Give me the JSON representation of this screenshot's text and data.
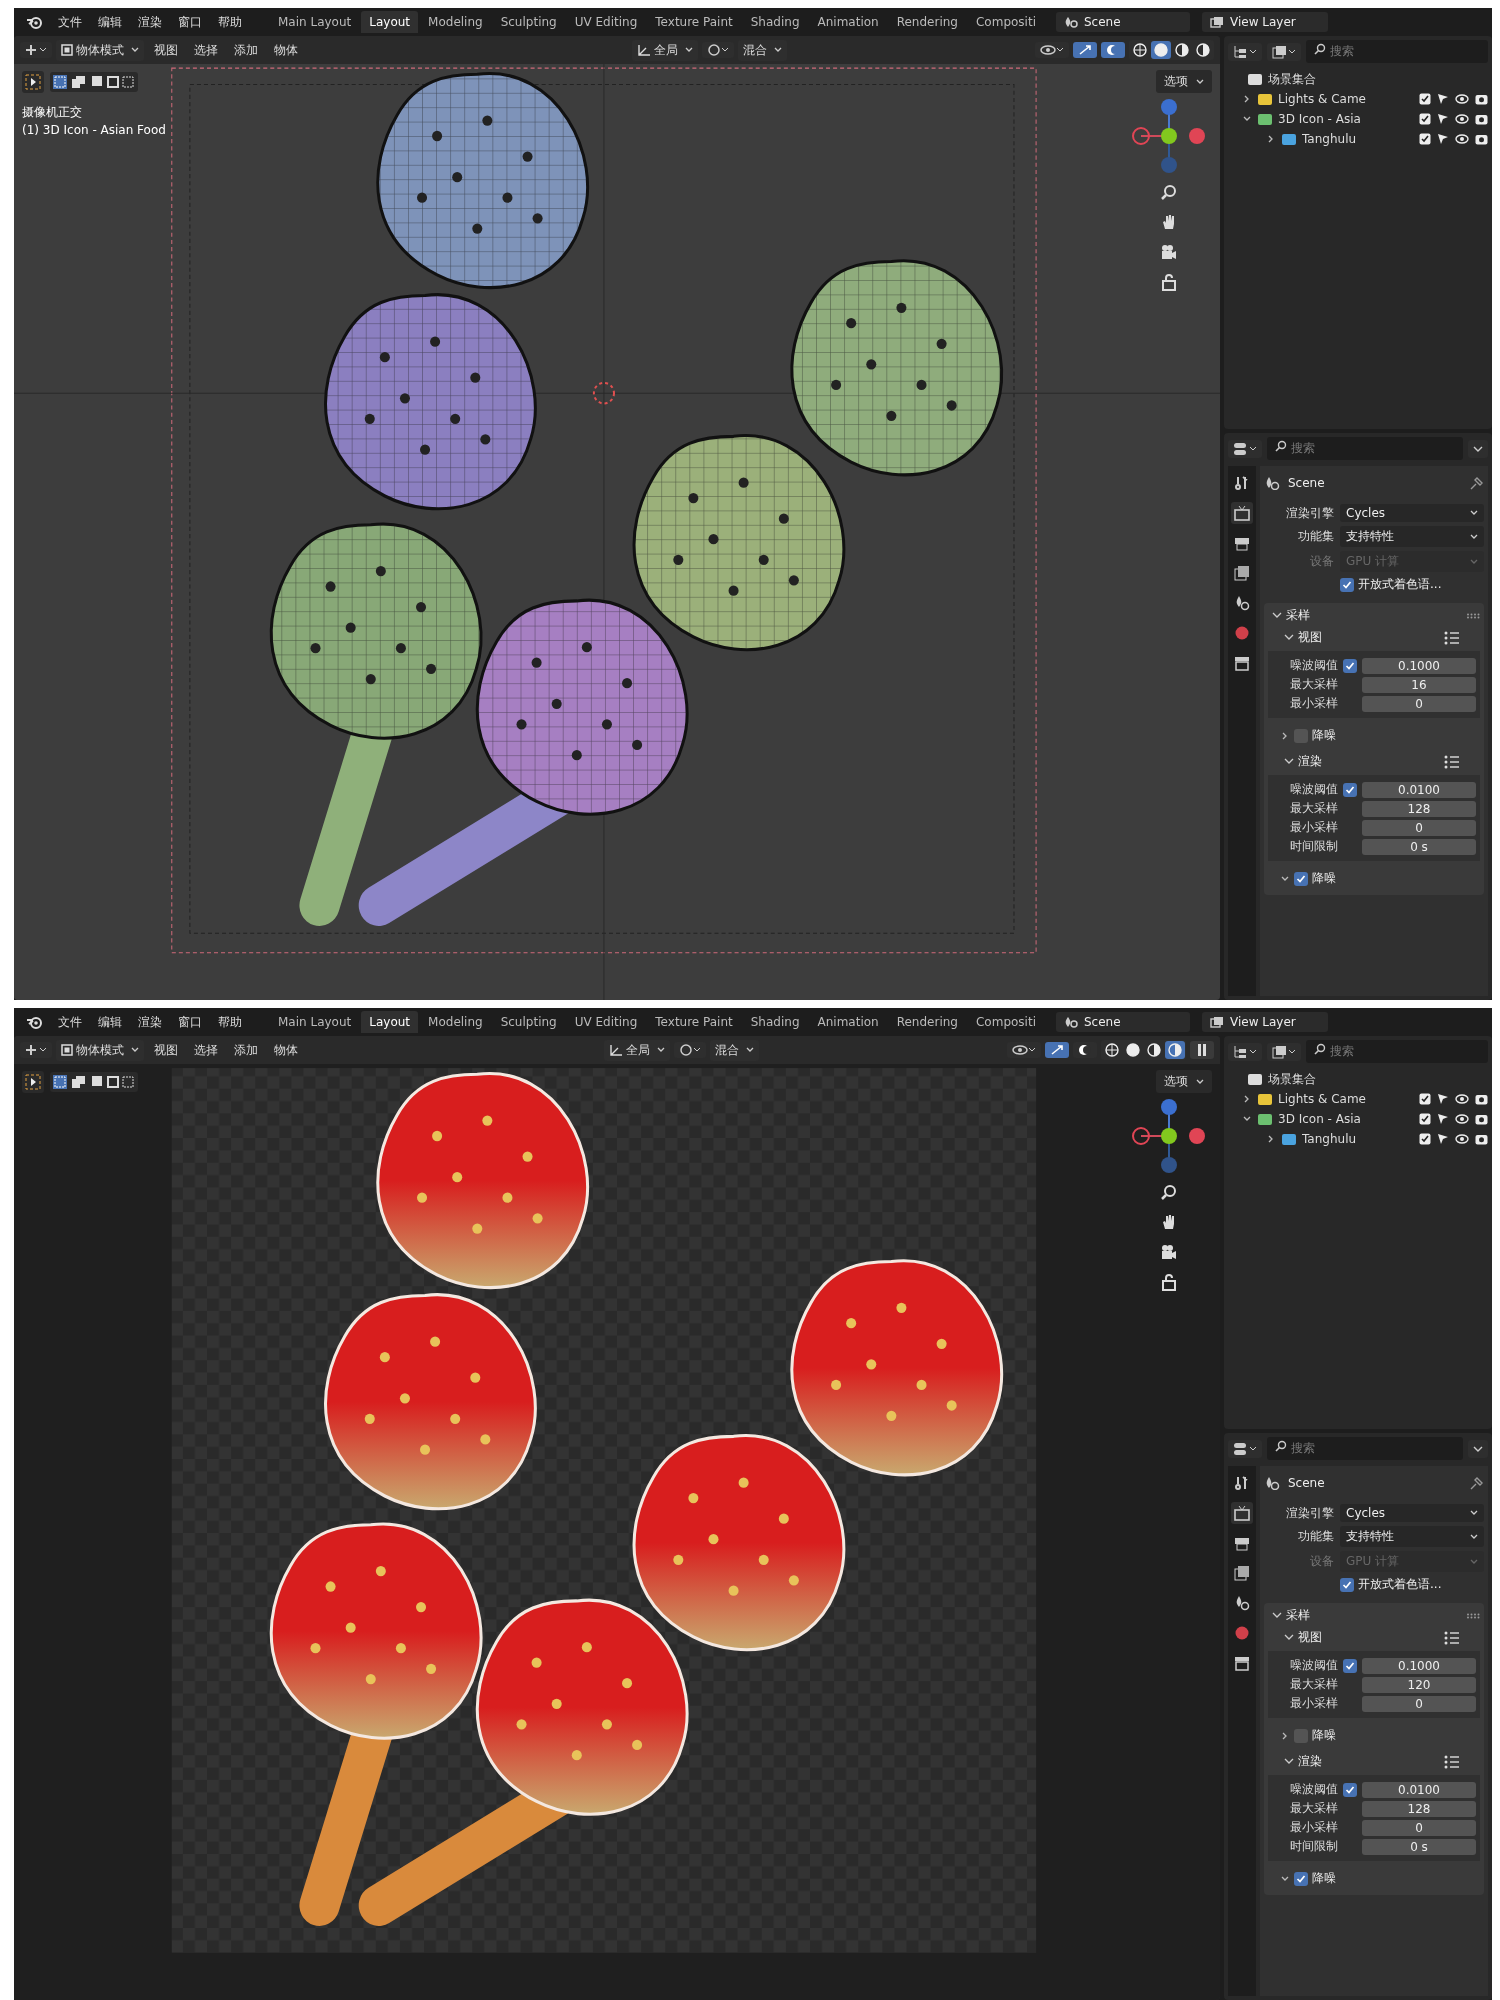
{
  "windows": [
    {
      "menus": [
        "文件",
        "编辑",
        "渲染",
        "窗口",
        "帮助"
      ],
      "workspaces": [
        {
          "label": "Main Layout",
          "selected": false
        },
        {
          "label": "Layout",
          "selected": true
        },
        {
          "label": "Modeling",
          "selected": false
        },
        {
          "label": "Sculpting",
          "selected": false
        },
        {
          "label": "UV Editing",
          "selected": false
        },
        {
          "label": "Texture Paint",
          "selected": false
        },
        {
          "label": "Shading",
          "selected": false
        },
        {
          "label": "Animation",
          "selected": false
        },
        {
          "label": "Rendering",
          "selected": false
        },
        {
          "label": "Compositi",
          "selected": false
        }
      ],
      "scene": "Scene",
      "view_layer": "View Layer",
      "toolbar": {
        "mode": "物体模式",
        "menus": [
          "视图",
          "选择",
          "添加",
          "物体"
        ],
        "orientation": "全局",
        "blend": "混合",
        "gizmo_on": true,
        "overlay_on": true
      },
      "shading": [
        {
          "selected": false
        },
        {
          "selected": true
        },
        {
          "selected": false
        },
        {
          "selected": false
        }
      ],
      "pause_button": false,
      "viewport": {
        "kind": "wireframe",
        "options_label": "选项",
        "overlay_lines": [
          "摄像机正交",
          "(1) 3D Icon - Asian Food"
        ]
      },
      "outliner": {
        "search_placeholder": "搜索",
        "root": "场景集合",
        "items": [
          {
            "label": "Lights & Came",
            "color": "#e8c53a",
            "expanded": false
          },
          {
            "label": "3D Icon - Asia",
            "color": "#6cc070",
            "expanded": true,
            "children": [
              {
                "label": "Tanghulu",
                "color": "#4aa3df",
                "expanded": false
              }
            ]
          }
        ]
      },
      "properties": {
        "search_placeholder": "搜索",
        "context": "Scene",
        "tabs": [
          {
            "kind": "tool",
            "selected": false
          },
          {
            "kind": "render",
            "selected": true
          },
          {
            "kind": "output",
            "selected": false
          },
          {
            "kind": "view-layer",
            "selected": false
          },
          {
            "kind": "scene",
            "selected": false
          },
          {
            "kind": "world",
            "selected": false
          },
          {
            "kind": "collection",
            "selected": false
          }
        ],
        "fields": [
          {
            "label": "渲染引擎",
            "value": "Cycles",
            "disabled": false
          },
          {
            "label": "功能集",
            "value": "支持特性",
            "disabled": false
          },
          {
            "label": "设备",
            "value": "GPU 计算",
            "disabled": true
          }
        ],
        "osl": {
          "label": "开放式着色语...",
          "checked": true
        },
        "section": "采样",
        "subsections": [
          {
            "title": "视图",
            "rows": [
              {
                "label": "噪波阈值",
                "value": "0.1000",
                "kind": "check",
                "checked": true
              },
              {
                "label": "最大采样",
                "value": "16",
                "kind": "number"
              },
              {
                "label": "最小采样",
                "value": "0",
                "kind": "number"
              }
            ],
            "denoise": {
              "label": "降噪",
              "checked": false,
              "expanded": false
            }
          },
          {
            "title": "渲染",
            "rows": [
              {
                "label": "噪波阈值",
                "value": "0.0100",
                "kind": "check",
                "checked": true
              },
              {
                "label": "最大采样",
                "value": "128",
                "kind": "number"
              },
              {
                "label": "最小采样",
                "value": "0",
                "kind": "number"
              },
              {
                "label": "时间限制",
                "value": "0 s",
                "kind": "number"
              }
            ],
            "denoise": {
              "label": "降噪",
              "checked": true,
              "expanded": true
            }
          }
        ]
      }
    },
    {
      "menus": [
        "文件",
        "编辑",
        "渲染",
        "窗口",
        "帮助"
      ],
      "workspaces": [
        {
          "label": "Main Layout",
          "selected": false
        },
        {
          "label": "Layout",
          "selected": true
        },
        {
          "label": "Modeling",
          "selected": false
        },
        {
          "label": "Sculpting",
          "selected": false
        },
        {
          "label": "UV Editing",
          "selected": false
        },
        {
          "label": "Texture Paint",
          "selected": false
        },
        {
          "label": "Shading",
          "selected": false
        },
        {
          "label": "Animation",
          "selected": false
        },
        {
          "label": "Rendering",
          "selected": false
        },
        {
          "label": "Compositi",
          "selected": false
        }
      ],
      "scene": "Scene",
      "view_layer": "View Layer",
      "toolbar": {
        "mode": "物体模式",
        "menus": [
          "视图",
          "选择",
          "添加",
          "物体"
        ],
        "orientation": "全局",
        "blend": "混合",
        "gizmo_on": true,
        "overlay_on": false
      },
      "shading": [
        {
          "selected": false
        },
        {
          "selected": false
        },
        {
          "selected": false
        },
        {
          "selected": true
        }
      ],
      "pause_button": true,
      "viewport": {
        "kind": "rendered",
        "options_label": "选项"
      },
      "outliner": {
        "search_placeholder": "搜索",
        "root": "场景集合",
        "items": [
          {
            "label": "Lights & Came",
            "color": "#e8c53a",
            "expanded": false
          },
          {
            "label": "3D Icon - Asia",
            "color": "#6cc070",
            "expanded": true,
            "children": [
              {
                "label": "Tanghulu",
                "color": "#4aa3df",
                "expanded": false
              }
            ]
          }
        ]
      },
      "properties": {
        "search_placeholder": "搜索",
        "context": "Scene",
        "tabs": [
          {
            "kind": "tool",
            "selected": false
          },
          {
            "kind": "render",
            "selected": true
          },
          {
            "kind": "output",
            "selected": false
          },
          {
            "kind": "view-layer",
            "selected": false
          },
          {
            "kind": "scene",
            "selected": false
          },
          {
            "kind": "world",
            "selected": false
          },
          {
            "kind": "collection",
            "selected": false
          }
        ],
        "fields": [
          {
            "label": "渲染引擎",
            "value": "Cycles",
            "disabled": false
          },
          {
            "label": "功能集",
            "value": "支持特性",
            "disabled": false
          },
          {
            "label": "设备",
            "value": "GPU 计算",
            "disabled": true
          }
        ],
        "osl": {
          "label": "开放式着色语...",
          "checked": true
        },
        "section": "采样",
        "subsections": [
          {
            "title": "视图",
            "rows": [
              {
                "label": "噪波阈值",
                "value": "0.1000",
                "kind": "check",
                "checked": true
              },
              {
                "label": "最大采样",
                "value": "120",
                "kind": "number"
              },
              {
                "label": "最小采样",
                "value": "0",
                "kind": "number"
              }
            ],
            "denoise": {
              "label": "降噪",
              "checked": false,
              "expanded": false
            }
          },
          {
            "title": "渲染",
            "rows": [
              {
                "label": "噪波阈值",
                "value": "0.0100",
                "kind": "check",
                "checked": true
              },
              {
                "label": "最大采样",
                "value": "128",
                "kind": "number"
              },
              {
                "label": "最小采样",
                "value": "0",
                "kind": "number"
              },
              {
                "label": "时间限制",
                "value": "0 s",
                "kind": "number"
              }
            ],
            "denoise": {
              "label": "降噪",
              "checked": true,
              "expanded": true
            }
          }
        ]
      }
    }
  ]
}
